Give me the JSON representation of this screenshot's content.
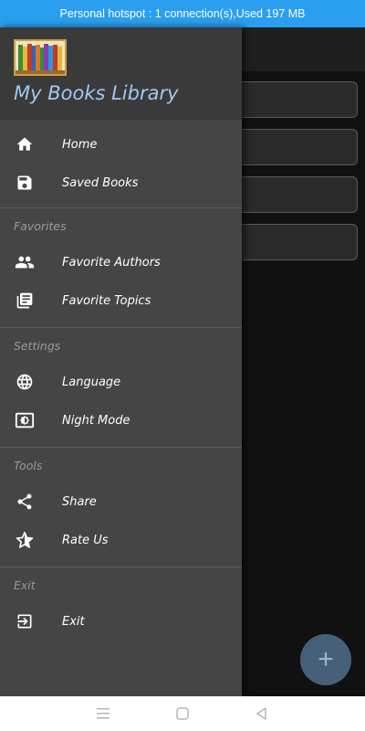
{
  "status_bar": {
    "text": "Personal hotspot : 1 connection(s),Used  197 MB"
  },
  "drawer": {
    "app_title": "My Books Library",
    "logo_icon": "books-logo-icon",
    "items": [
      {
        "label": "Home",
        "icon": "home-icon"
      },
      {
        "label": "Saved Books",
        "icon": "save-icon"
      }
    ],
    "sections": [
      {
        "header": "Favorites",
        "items": [
          {
            "label": "Favorite Authors",
            "icon": "people-icon"
          },
          {
            "label": "Favorite Topics",
            "icon": "library-books-icon"
          }
        ]
      },
      {
        "header": "Settings",
        "items": [
          {
            "label": "Language",
            "icon": "globe-icon"
          },
          {
            "label": "Night Mode",
            "icon": "brightness-icon"
          }
        ]
      },
      {
        "header": "Tools",
        "items": [
          {
            "label": "Share",
            "icon": "share-icon"
          },
          {
            "label": "Rate Us",
            "icon": "star-icon"
          }
        ]
      },
      {
        "header": "Exit",
        "items": [
          {
            "label": "Exit",
            "icon": "exit-icon"
          }
        ]
      }
    ]
  },
  "fab": {
    "label": "+"
  },
  "colors": {
    "status_bar": "#2a9ff0",
    "drawer_bg": "#454545",
    "drawer_header_bg": "#3a3a3a",
    "title_color": "#9fc9f4",
    "fab_bg": "#46607a"
  }
}
